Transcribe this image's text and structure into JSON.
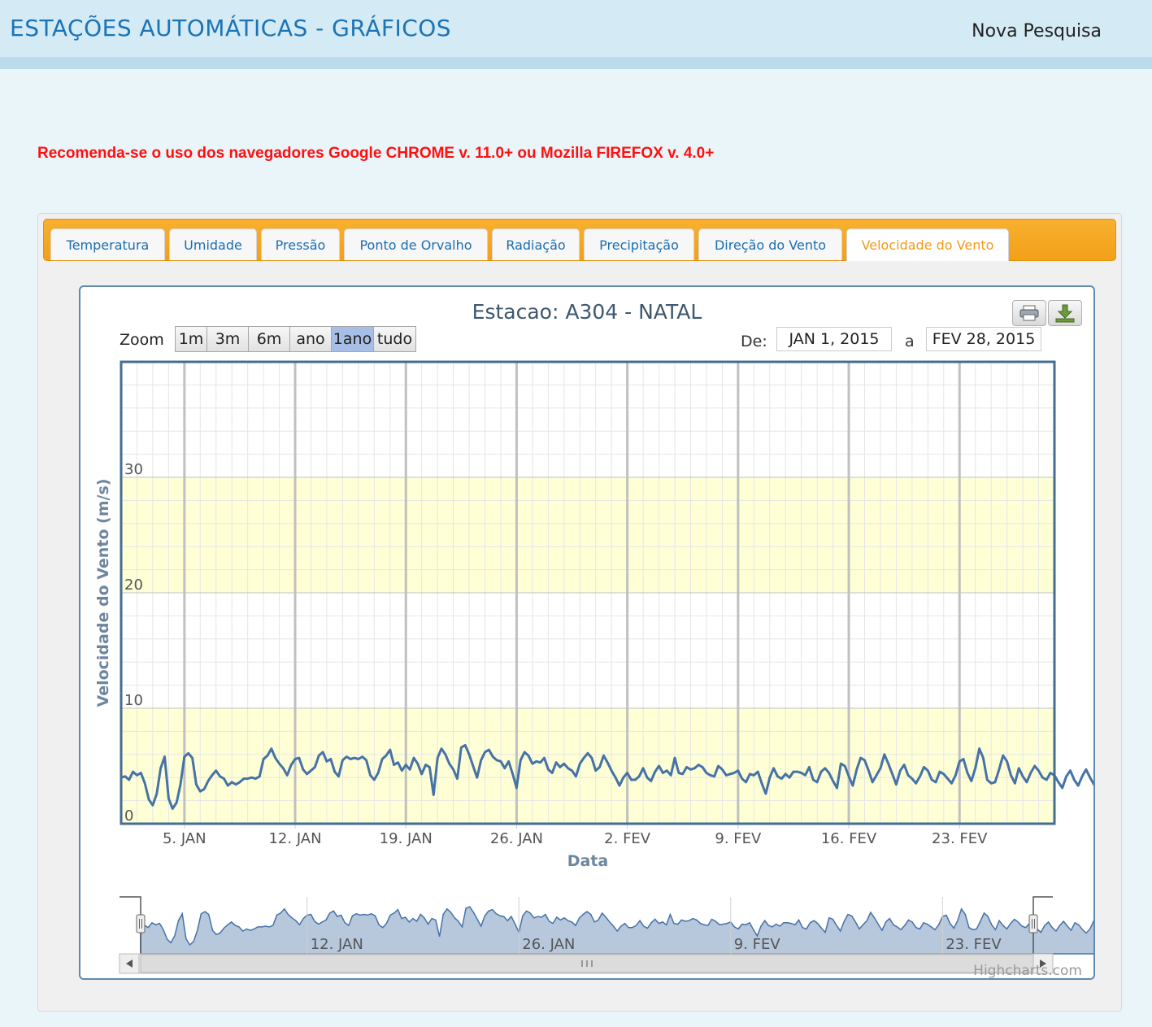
{
  "header": {
    "title": "ESTAÇÕES AUTOMÁTICAS - GRÁFICOS",
    "new_search": "Nova Pesquisa"
  },
  "warning": "Recomenda-se o uso dos navegadores Google CHROME v. 11.0+ ou Mozilla FIREFOX v. 4.0+",
  "tabs": [
    {
      "label": "Temperatura",
      "active": false
    },
    {
      "label": "Umidade",
      "active": false
    },
    {
      "label": "Pressão",
      "active": false
    },
    {
      "label": "Ponto de Orvalho",
      "active": false
    },
    {
      "label": "Radiação",
      "active": false
    },
    {
      "label": "Precipitação",
      "active": false
    },
    {
      "label": "Direção do Vento",
      "active": false
    },
    {
      "label": "Velocidade do Vento",
      "active": true
    }
  ],
  "chart": {
    "zoom_label": "Zoom",
    "zoom_buttons": [
      "1m",
      "3m",
      "6m",
      "ano",
      "1ano",
      "tudo"
    ],
    "zoom_selected": "1ano",
    "range_from_label": "De:",
    "range_from": "JAN 1, 2015",
    "range_to_label": "a",
    "range_to": "FEV 28, 2015",
    "print_icon": "printer-icon",
    "export_icon": "download-icon",
    "credit": "Highcharts.com"
  },
  "chart_data": {
    "type": "line",
    "title": "Estacao: A304 - NATAL",
    "xlabel": "Data",
    "ylabel": "Velocidade do Vento (m/s)",
    "x_range": [
      "2015-01-01",
      "2015-02-28"
    ],
    "ylim": [
      0,
      40
    ],
    "y_ticks": [
      0,
      10,
      20,
      30
    ],
    "x_ticks": [
      {
        "date": "2015-01-05",
        "label": "5. JAN"
      },
      {
        "date": "2015-01-12",
        "label": "12. JAN"
      },
      {
        "date": "2015-01-19",
        "label": "19. JAN"
      },
      {
        "date": "2015-01-26",
        "label": "26. JAN"
      },
      {
        "date": "2015-02-02",
        "label": "2. FEV"
      },
      {
        "date": "2015-02-09",
        "label": "9. FEV"
      },
      {
        "date": "2015-02-16",
        "label": "16. FEV"
      },
      {
        "date": "2015-02-23",
        "label": "23. FEV"
      }
    ],
    "bands": [
      {
        "from": 0,
        "to": 10,
        "color": "#ffffd6"
      },
      {
        "from": 20,
        "to": 30,
        "color": "#ffffd6"
      }
    ],
    "navigator_ticks": [
      {
        "date": "2015-01-12",
        "label": "12. JAN"
      },
      {
        "date": "2015-01-26",
        "label": "26. JAN"
      },
      {
        "date": "2015-02-09",
        "label": "9. FEV"
      },
      {
        "date": "2015-02-23",
        "label": "23. FEV"
      }
    ],
    "grid": true,
    "legend": "none",
    "line_color": "#4572a7",
    "series": [
      {
        "start": "2015-01-01",
        "interval_hours": 6,
        "values": [
          4.0,
          4.1,
          3.8,
          4.5,
          4.2,
          4.4,
          3.5,
          2.1,
          1.6,
          2.6,
          4.8,
          5.8,
          2.2,
          1.3,
          1.8,
          3.4,
          5.8,
          6.1,
          5.7,
          3.4,
          2.8,
          3.0,
          3.7,
          4.2,
          4.6,
          4.1,
          3.9,
          3.3,
          3.6,
          3.4,
          3.6,
          3.9,
          3.9,
          4.0,
          3.9,
          4.1,
          5.6,
          5.9,
          6.5,
          5.7,
          5.2,
          4.8,
          4.2,
          5.1,
          5.6,
          5.7,
          4.7,
          4.3,
          4.6,
          4.9,
          5.9,
          6.2,
          5.4,
          5.6,
          4.5,
          4.1,
          5.5,
          5.8,
          5.6,
          5.7,
          5.6,
          5.8,
          5.5,
          4.2,
          3.8,
          4.4,
          5.6,
          5.9,
          6.4,
          5.1,
          5.3,
          4.6,
          5.1,
          4.7,
          5.7,
          5.2,
          4.3,
          5.1,
          4.9,
          2.5,
          5.7,
          6.5,
          6.0,
          5.2,
          4.7,
          3.9,
          6.6,
          6.8,
          6.0,
          5.0,
          4.0,
          5.5,
          6.2,
          6.4,
          5.8,
          5.5,
          5.4,
          4.8,
          5.4,
          4.3,
          3.1,
          5.5,
          6.2,
          5.9,
          5.2,
          5.4,
          5.3,
          5.7,
          4.7,
          4.4,
          5.3,
          4.9,
          5.2,
          4.8,
          4.6,
          4.1,
          5.2,
          5.7,
          6.1,
          5.7,
          4.6,
          4.9,
          5.9,
          5.3,
          4.6,
          4.0,
          3.3,
          4.0,
          4.4,
          3.8,
          3.8,
          4.1,
          4.8,
          4.0,
          3.7,
          4.5,
          5.0,
          4.4,
          4.6,
          4.2,
          5.7,
          4.4,
          4.3,
          4.9,
          4.7,
          4.8,
          5.1,
          4.9,
          4.4,
          4.2,
          4.1,
          5.0,
          4.7,
          4.2,
          4.3,
          4.4,
          4.6,
          3.9,
          3.6,
          4.3,
          4.2,
          4.5,
          3.5,
          2.6,
          4.0,
          4.8,
          4.1,
          3.9,
          4.3,
          4.0,
          4.5,
          4.5,
          4.4,
          4.2,
          4.9,
          3.8,
          3.6,
          4.5,
          4.8,
          4.4,
          3.7,
          3.1,
          5.2,
          5.0,
          4.1,
          3.3,
          4.7,
          5.7,
          5.5,
          4.6,
          3.6,
          4.2,
          4.8,
          6.0,
          5.2,
          4.3,
          3.4,
          4.6,
          5.1,
          4.2,
          3.9,
          3.5,
          4.1,
          4.9,
          4.6,
          3.8,
          3.6,
          4.5,
          4.3,
          3.9,
          3.5,
          4.2,
          5.4,
          5.6,
          4.4,
          3.7,
          4.8,
          6.5,
          5.7,
          3.8,
          3.5,
          3.6,
          4.7,
          5.9,
          5.4,
          4.2,
          3.5,
          4.8,
          4.1,
          3.6,
          4.4,
          5.0,
          4.6,
          4.0,
          3.8,
          4.4,
          4.2,
          3.6,
          3.1,
          4.1,
          4.6,
          3.8,
          3.3,
          4.1,
          4.7,
          4.0,
          3.4,
          4.5,
          4.2,
          3.5,
          3.0,
          3.6,
          4.8,
          4.5,
          3.9,
          3.5,
          4.5,
          5.4,
          4.0,
          3.1,
          4.3,
          5.8,
          4.4,
          3.7,
          6.0,
          5.4,
          3.8,
          3.4,
          4.5,
          6.7,
          6.4,
          5.0,
          3.1,
          4.2,
          6.6,
          5.2,
          5.6,
          5.4,
          3.6,
          5.4,
          6.0,
          5.7,
          5.9,
          5.0,
          5.3,
          5.6,
          4.8,
          5.1,
          5.2,
          4.6,
          5.5,
          5.1,
          4.4,
          4.7,
          5.7,
          5.4,
          4.8,
          4.4,
          5.4,
          6.2,
          5.6,
          4.4,
          4.1,
          4.4,
          4.6,
          3.8,
          4.2,
          4.5,
          4.4,
          4.1,
          3.8,
          3.5,
          4.4,
          4.5,
          4.0,
          4.2,
          4.4,
          4.3,
          3.9,
          4.1,
          4.6,
          5.1,
          4.6,
          4.1,
          4.7,
          5.4,
          4.4,
          3.9,
          4.6,
          5.6,
          4.6,
          3.6,
          4.9,
          5.0,
          4.0,
          3.5,
          4.2,
          3.9,
          3.3,
          3.6,
          4.3,
          5.3,
          5.2,
          5.0,
          5.3,
          5.1,
          4.7,
          5.3,
          5.5,
          5.0,
          3.4,
          2.8,
          2.9,
          2.4,
          1.6,
          1.2,
          1.0,
          1.6,
          1.4,
          0.9,
          1.2,
          1.0,
          1.5,
          1.8,
          2.7,
          4.0,
          4.1,
          4.1,
          3.7,
          2.7,
          2.5,
          3.0,
          3.7,
          3.4,
          3.6,
          3.9,
          3.5,
          3.3,
          3.0,
          3.7,
          4.2,
          3.9,
          4.3,
          4.0,
          3.9,
          3.8,
          3.5,
          3.8,
          4.6,
          4.9,
          3.9,
          3.9,
          3.6,
          3.7,
          3.8,
          3.7,
          4.3,
          4.2,
          4.5,
          5.1,
          5.5,
          4.6,
          3.6,
          4.0,
          4.5,
          4.3,
          3.8,
          4.0,
          5.6,
          5.5,
          5.1,
          4.2,
          3.9,
          3.4,
          4.0,
          3.8,
          4.6,
          5.0,
          5.4,
          4.3,
          3.3,
          3.2,
          3.4,
          4.3
        ]
      }
    ]
  }
}
